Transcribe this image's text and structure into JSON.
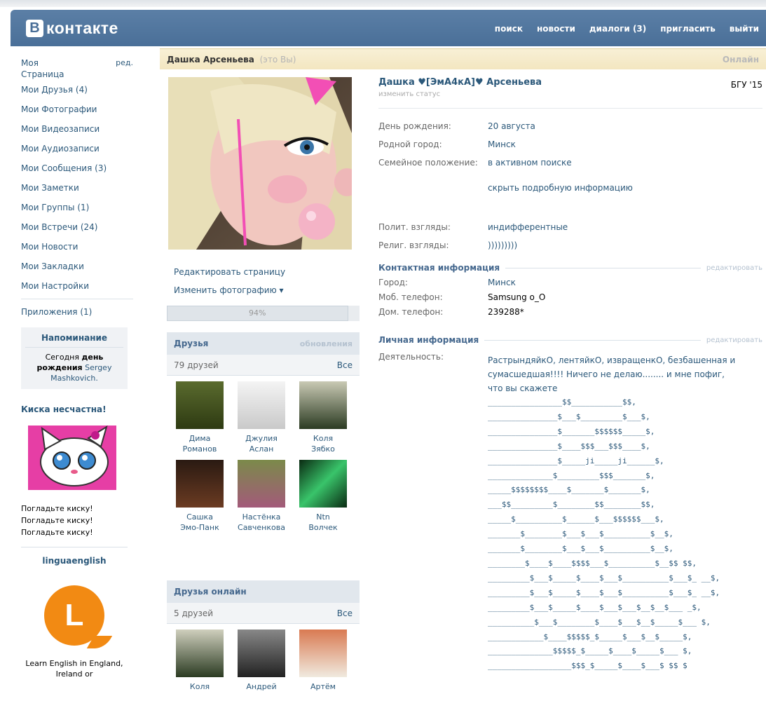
{
  "header": {
    "logo_letter": "В",
    "logo_text": "контакте",
    "nav": [
      "поиск",
      "новости",
      "диалоги (3)",
      "пригласить",
      "выйти"
    ]
  },
  "sidebar": {
    "my_page": "Моя Страница",
    "edit": "ред.",
    "items": [
      "Мои Друзья (4)",
      "Мои Фотографии",
      "Мои Видеозаписи",
      "Мои Аудиозаписи",
      "Мои Сообщения (3)",
      "Мои Заметки",
      "Мои Группы (1)",
      "Мои Встречи (24)",
      "Мои Новости",
      "Мои Закладки",
      "Мои Настройки"
    ],
    "apps": "Приложения (1)"
  },
  "reminder": {
    "title": "Напоминание",
    "text_1": "Сегодня",
    "text_bold": "день рождения",
    "name": "Sergey Mashkovich."
  },
  "ad1": {
    "title": "Киска несчастна!",
    "lines": [
      "Погладьте киску!",
      "Погладьте киску!",
      "Погладьте киску!"
    ]
  },
  "ad2": {
    "title": "linguaenglish",
    "logo_letter": "L",
    "text": "Learn English in England, Ireland or"
  },
  "titlebar": {
    "name": "Дашка Арсеньева",
    "you": "(это Вы)",
    "online": "Онлайн"
  },
  "photo_actions": {
    "edit_page": "Редактировать страницу",
    "change_photo": "Изменить фотографию ▾",
    "progress_label": "94%",
    "progress_value": 0.94
  },
  "friends": {
    "title": "Друзья",
    "updates": "обновления",
    "count": "79 друзей",
    "all": "Все",
    "items": [
      {
        "first": "Дима",
        "last": "Романов"
      },
      {
        "first": "Джулия",
        "last": "Аслан"
      },
      {
        "first": "Коля",
        "last": "Зябко"
      },
      {
        "first": "Сашка",
        "last": "Эмо-Панк"
      },
      {
        "first": "Настёнка",
        "last": "Савченкова"
      },
      {
        "first": "Ntn",
        "last": "Волчек"
      }
    ]
  },
  "friends_online": {
    "title": "Друзья онлайн",
    "count": "5 друзей",
    "all": "Все",
    "items": [
      {
        "first": "Коля"
      },
      {
        "first": "Андрей"
      },
      {
        "first": "Артём"
      }
    ]
  },
  "profile": {
    "full_name": "Дашка ♥[ЭмА4кА]♥ Арсеньева",
    "change_status": "изменить статус",
    "university": "БГУ '15",
    "basic": [
      {
        "k": "День рождения:",
        "v": "20 августа"
      },
      {
        "k": "Родной город:",
        "v": "Минск"
      },
      {
        "k": "Семейное положение:",
        "v": "в активном поиске"
      }
    ],
    "hide_details": "скрыть подробную информацию",
    "views": [
      {
        "k": "Полит. взгляды:",
        "v": "индифферентные"
      },
      {
        "k": "Религ. взгляды:",
        "v": ")))))))))"
      }
    ],
    "contact_title": "Контактная информация",
    "contact_edit": "редактировать",
    "contacts": [
      {
        "k": "Город:",
        "v": "Минск"
      },
      {
        "k": "Моб. телефон:",
        "v": "Samsung o_O"
      },
      {
        "k": "Дом. телефон:",
        "v": "239288*"
      }
    ],
    "personal_title": "Личная информация",
    "personal_edit": "редактировать",
    "activity_label": "Деятельность:",
    "activity_text": "РастрындяйкО, лентяйкО, извращенкО, безбашенная и сумасшедшая!!!! Ничего не делаю........ и мне пофиг, что вы скажете",
    "art": "________________$$___________$$,\n_______________$___$_________$___$,\n_______________$_______$$$$$$_____$,\n_______________$____$$$___$$$____$,\n_______________$_____ji_____ji______$,\n______________$_________$$$_______$,\n_____$$$$$$$$____$_______$_______$,\n___$$_________$________$$________$$,\n_____$__________$______$___$$$$$$___$,\n_______$________$___$___$__________$__$,\n_______$________$___$___$__________$__$,\n________$____$____$$$$___$__________$__$$ $$,\n_________$___$_____$____$___$__________$___$_ __$,\n_________$___$_____$____$___$__________$___$_ __$,\n_________$___$_____$____$___$___$__$__$___ _$,\n__________$___$________$____$___$__$_____$___ $,\n____________$____$$$$$_$_____$___$__$_____$,\n______________$$$$$_$_____$____$_____$___ $,\n__________________$$$_$_____$____$___$ $$ $"
  }
}
